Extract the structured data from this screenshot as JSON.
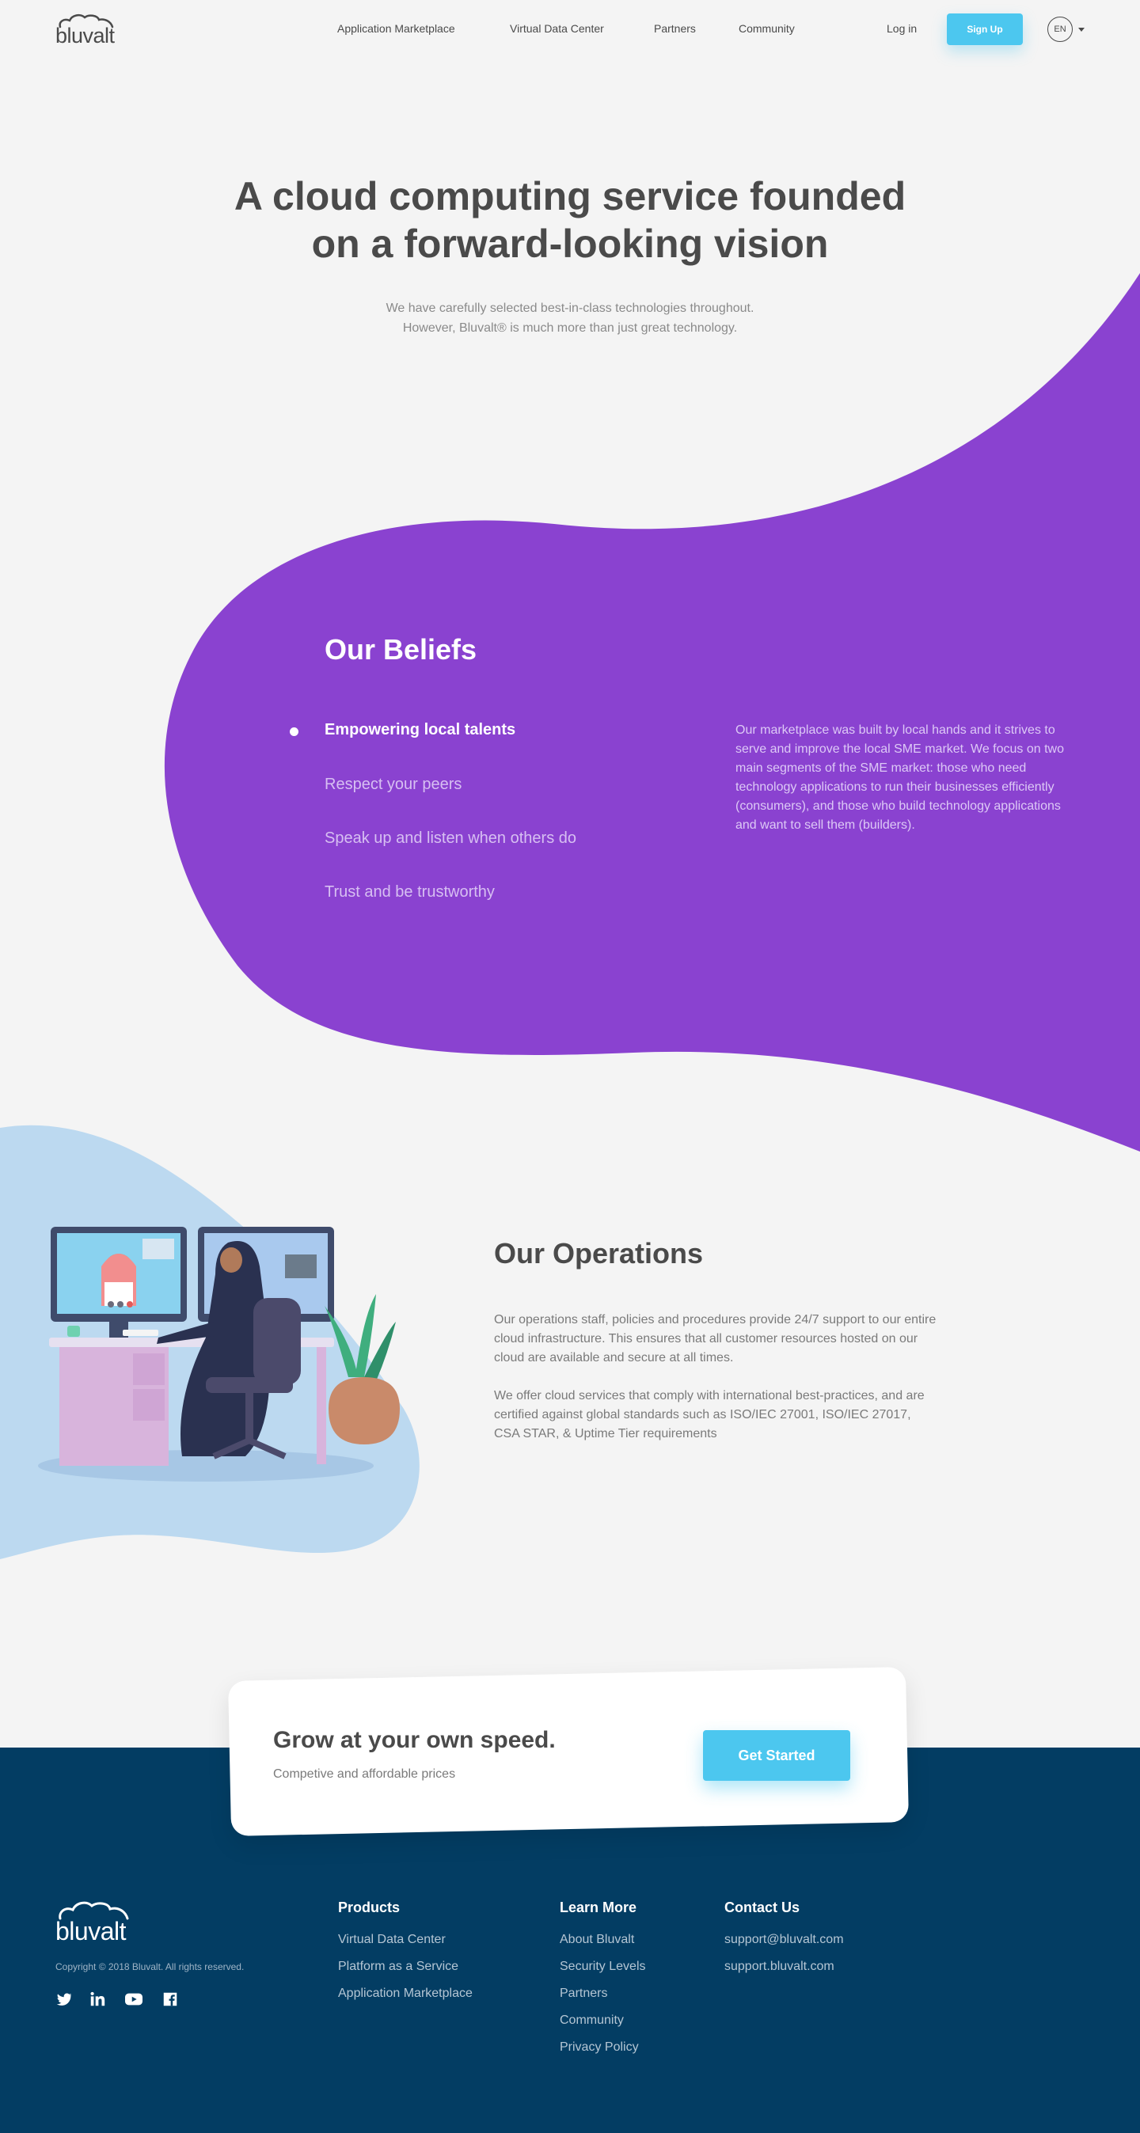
{
  "brand": {
    "name": "bluvalt"
  },
  "nav": {
    "links": [
      "Application Marketplace",
      "Virtual Data Center",
      "Partners",
      "Community"
    ],
    "login": "Log in",
    "signup": "Sign Up",
    "lang": "EN"
  },
  "hero": {
    "title_line1": "A cloud computing service founded",
    "title_line2": "on a forward-looking vision",
    "sub_line1": "We have carefully selected best-in-class technologies throughout.",
    "sub_line2": "However, Bluvalt® is much more than just great technology."
  },
  "beliefs": {
    "title": "Our Beliefs",
    "items": [
      "Empowering local talents",
      "Respect your peers",
      "Speak up and listen when others do",
      "Trust and be trustworthy"
    ],
    "active_index": 0,
    "description": "Our marketplace was built by local hands and it strives to serve and improve the local SME market. We focus on two main segments of the SME market: those who need technology applications to run their businesses efficiently (consumers), and those who build technology applications and want to sell them (builders)."
  },
  "operations": {
    "title": "Our Operations",
    "p1": "Our operations staff, policies and procedures provide 24/7 support to our entire cloud infrastructure. This ensures that all customer resources hosted on our cloud are available and secure at all times.",
    "p2": "We offer cloud services that comply with international best-practices, and are certified against global standards such as ISO/IEC 27001, ISO/IEC 27017, CSA STAR, & Uptime Tier requirements"
  },
  "cta": {
    "title": "Grow at your own speed.",
    "subtitle": "Competive and affordable prices",
    "button": "Get Started"
  },
  "footer": {
    "copyright": "Copyright © 2018 Bluvalt. All rights reserved.",
    "social_icons": [
      "twitter-icon",
      "linkedin-icon",
      "youtube-icon",
      "facebook-icon"
    ],
    "columns": [
      {
        "heading": "Products",
        "links": [
          "Virtual Data Center",
          "Platform as a Service",
          "Application Marketplace"
        ]
      },
      {
        "heading": "Learn More",
        "links": [
          "About Bluvalt",
          "Security Levels",
          "Partners",
          "Community",
          "Privacy Policy"
        ]
      },
      {
        "heading": "Contact Us",
        "links": [
          "support@bluvalt.com",
          "support.bluvalt.com"
        ]
      }
    ]
  },
  "colors": {
    "purple": "#8a42d0",
    "accent": "#4cc7ef",
    "footer": "#033d63",
    "light_blue": "#bcd9f0",
    "background": "#f4f4f4"
  }
}
